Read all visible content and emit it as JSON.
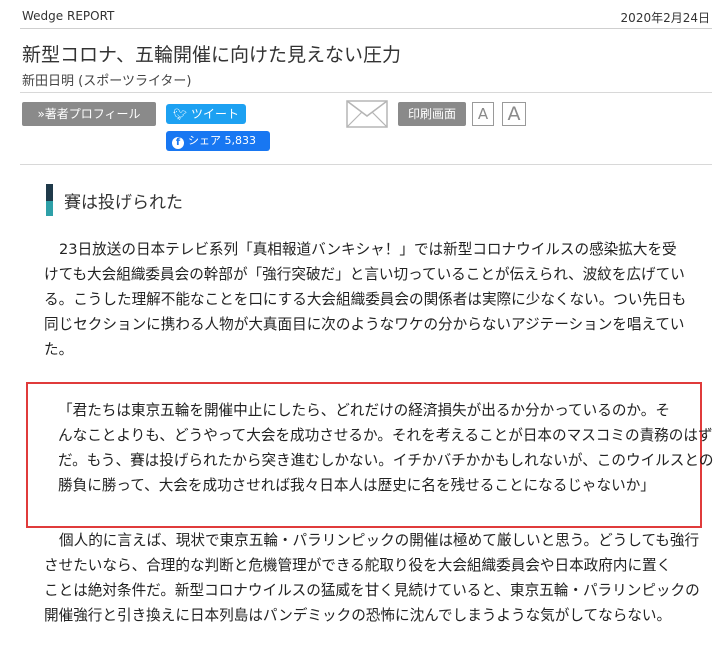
{
  "header": {
    "brand": "Wedge REPORT",
    "date": "2020年2月24日"
  },
  "article": {
    "title": "新型コロナ、五輪開催に向けた見えない圧力",
    "author": "新田日明 (スポーツライター)"
  },
  "toolbar": {
    "profile_label": "»著者プロフィール",
    "tweet_label": "ツイート",
    "share_label": "シェア 5,833",
    "print_label": "印刷画面",
    "font_small": "A",
    "font_large": "A"
  },
  "section": {
    "heading": "賽は投げられた"
  },
  "body": {
    "p1": [
      "23日放送の日本テレビ系列「真相報道バンキシャ！」では新型コロナウイルスの感染拡大を受",
      "けても大会組織委員会の幹部が「強行突破だ」と言い切っていることが伝えられ、波紋を広げてい",
      "る。こうした理解不能なことを口にする大会組織委員会の関係者は実際に少なくない。つい先日も",
      "同じセクションに携わる人物が大真面目に次のようなワケの分からないアジテーションを唱えてい",
      "た。"
    ],
    "quote": [
      "「君たちは東京五輪を開催中止にしたら、どれだけの経済損失が出るか分かっているのか。そ",
      "んなことよりも、どうやって大会を成功させるか。それを考えることが日本のマスコミの責務のはず",
      "だ。もう、賽は投げられたから突き進むしかない。イチかバチかかもしれないが、このウイルスとの",
      "勝負に勝って、大会を成功させれば我々日本人は歴史に名を残せることになるじゃないか」"
    ],
    "p2": [
      "個人的に言えば、現状で東京五輪・パラリンピックの開催は極めて厳しいと思う。どうしても強行",
      "させたいなら、合理的な判断と危機管理ができる舵取り役を大会組織委員会や日本政府内に置く",
      "ことは絶対条件だ。新型コロナウイルスの猛威を甘く見続けていると、東京五輪・パラリンピックの",
      "開催強行と引き換えに日本列島はパンデミックの恐怖に沈んでしまうような気がしてならない。"
    ]
  },
  "colors": {
    "tweet_bg": "#1da1f2",
    "share_bg": "#1877f2",
    "quote_border": "#e03b3b",
    "heading_bar_dark": "#1f3a4a",
    "heading_bar_teal": "#2ea0a8"
  }
}
